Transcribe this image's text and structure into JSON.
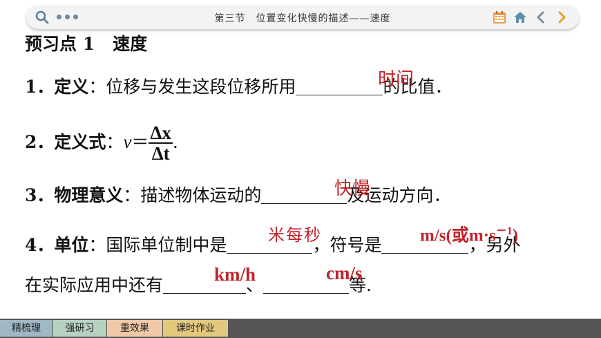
{
  "toolbar": {
    "title": "第三节　位置变化快慢的描述——速度"
  },
  "heading": {
    "prefix": "预习点 1",
    "title": "速度"
  },
  "items": [
    {
      "num": "1．",
      "label": "定义",
      "text_before": "：位移与发生这段位移所用",
      "text_after": "的比值．",
      "answer": "时间"
    },
    {
      "num": "2．",
      "label": "定义式",
      "text_before": "：",
      "formula_var": "v",
      "formula_eq": "＝",
      "numerator": "Δx",
      "denominator": "Δt",
      "text_after": "."
    },
    {
      "num": "3．",
      "label": "物理意义",
      "text_before": "：描述物体运动的",
      "text_after": "及运动方向．",
      "answer": "快慢"
    },
    {
      "num": "4．",
      "label": "单位",
      "text_before": "：国际单位制中是",
      "text_mid": "，符号是",
      "text_after": "，另外",
      "answer1": "米每秒",
      "answer2": "m/s(或m·s",
      "answer2_sup": "－1",
      "answer2_end": ")"
    },
    {
      "text_before": "在实际应用中还有",
      "sep": "、",
      "text_after": "等.",
      "answer1": "km/h",
      "answer2": "cm/s"
    }
  ],
  "tabs": [
    "精梳理",
    "强研习",
    "重效果",
    "课时作业"
  ],
  "colors": {
    "answer": "#c0242a",
    "bottom_bar": "#555555"
  }
}
